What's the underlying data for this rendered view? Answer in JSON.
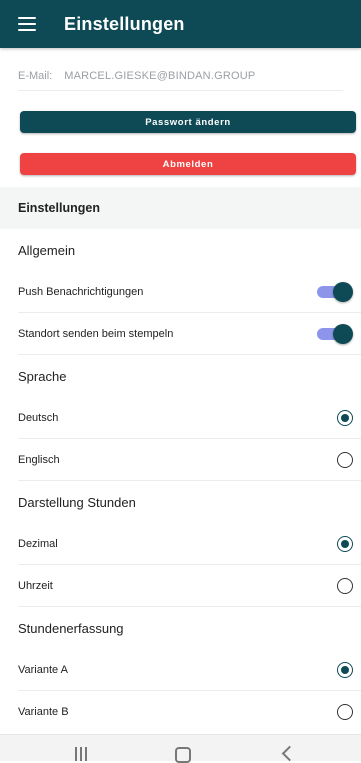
{
  "appbar": {
    "title": "Einstellungen",
    "menu_icon": "menu-icon"
  },
  "account": {
    "email_label": "E-Mail:",
    "email_value": "MARCEL.GIESKE@BINDAN.GROUP"
  },
  "buttons": {
    "change_password": "Passwort ändern",
    "logout": "Abmelden"
  },
  "colors": {
    "primary": "#0e4a55",
    "danger": "#ef4343",
    "toggle_track": "#8c95ea"
  },
  "section_header": "Einstellungen",
  "general": {
    "title": "Allgemein",
    "push": {
      "label": "Push Benachrichtigungen",
      "enabled": true
    },
    "location": {
      "label": "Standort senden beim stempeln",
      "enabled": true
    }
  },
  "language": {
    "title": "Sprache",
    "options": [
      {
        "label": "Deutsch",
        "selected": true
      },
      {
        "label": "Englisch",
        "selected": false
      }
    ]
  },
  "hours_display": {
    "title": "Darstellung Stunden",
    "options": [
      {
        "label": "Dezimal",
        "selected": true
      },
      {
        "label": "Uhrzeit",
        "selected": false
      }
    ]
  },
  "time_tracking": {
    "title": "Stundenerfassung",
    "options": [
      {
        "label": "Variante A",
        "selected": true
      },
      {
        "label": "Variante B",
        "selected": false
      }
    ]
  },
  "system_nav": {
    "recent_icon": "recent-apps-icon",
    "home_icon": "home-icon",
    "back_icon": "back-icon"
  }
}
